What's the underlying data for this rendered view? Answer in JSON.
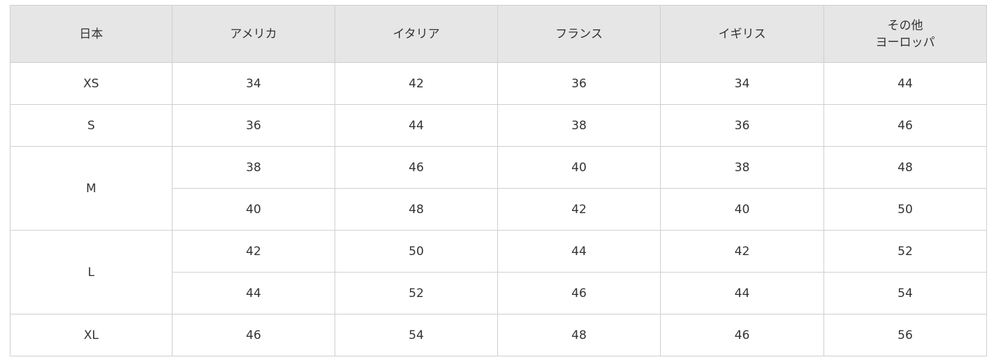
{
  "table": {
    "headers": {
      "japan": "日本",
      "usa": "アメリカ",
      "italy": "イタリア",
      "france": "フランス",
      "uk": "イギリス",
      "other_line1": "その他",
      "other_line2": "ヨーロッパ"
    },
    "rows": [
      {
        "japan": "XS",
        "usa": "34",
        "italy": "42",
        "france": "36",
        "uk": "34",
        "other": "44"
      },
      {
        "japan": "S",
        "usa": "36",
        "italy": "44",
        "france": "38",
        "uk": "36",
        "other": "46"
      },
      {
        "japan": "M",
        "usa": "38",
        "italy": "46",
        "france": "40",
        "uk": "38",
        "other": "48"
      },
      {
        "usa": "40",
        "italy": "48",
        "france": "42",
        "uk": "40",
        "other": "50"
      },
      {
        "japan": "L",
        "usa": "42",
        "italy": "50",
        "france": "44",
        "uk": "42",
        "other": "52"
      },
      {
        "usa": "44",
        "italy": "52",
        "france": "46",
        "uk": "44",
        "other": "54"
      },
      {
        "japan": "XL",
        "usa": "46",
        "italy": "54",
        "france": "48",
        "uk": "46",
        "other": "56"
      }
    ]
  }
}
